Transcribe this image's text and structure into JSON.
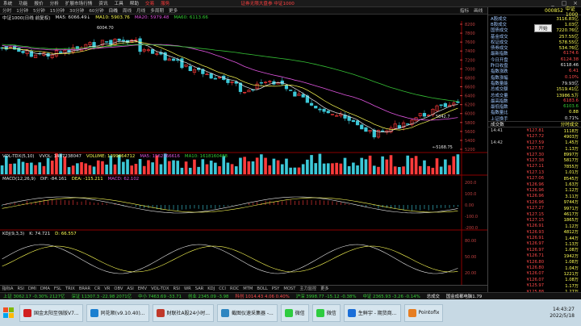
{
  "colors": {
    "up": "#ff3b3b",
    "down": "#3cc8d8",
    "ma5": "#e8e8e8",
    "ma10": "#ffff55",
    "ma20": "#e055e0",
    "ma60": "#35c035",
    "background": "#000000"
  },
  "menu": {
    "items": [
      "系统",
      "功能",
      "报价",
      "分析",
      "扩展市场行情",
      "资讯",
      "工具",
      "帮助"
    ],
    "badges": [
      "交易",
      "服务"
    ],
    "notice": "证券无限大盘参  中证1000",
    "window_buttons": [
      "_",
      "□",
      "×"
    ]
  },
  "toolbar": {
    "periods": [
      "分时",
      "1分钟",
      "5分钟",
      "15分钟",
      "30分钟",
      "60分钟",
      "日线",
      "周线",
      "月线",
      "多周期",
      "更多"
    ],
    "tools": [
      "指标",
      "画线",
      "复权",
      "叠加",
      "统计",
      "标记",
      "F10",
      "F11",
      "对比"
    ]
  },
  "chart_header": {
    "title": "中证1000(日线 前复权)",
    "ma5": "MA5: 6066.49↓",
    "ma10": "MA10: 5903.76",
    "ma20": "MA20: 5979.48",
    "ma60": "MA60: 6113.66"
  },
  "volume_header": {
    "label": "VOL-TDX(5,10)",
    "vvol": "VVOL: 1487238047",
    "volume": "VOLUME: 1399864712",
    "ma5": "MA5: 1562366616",
    "ma10": "MA10: 1618160488"
  },
  "macd_header": {
    "label": "MACD(12,26,9)",
    "dif": "DIF: -84.161",
    "dea": "DEA: -115.211",
    "macd": "MACD: 62.102"
  },
  "kdj_header": {
    "label": "KDJ(9,3,3)",
    "k": "K: 74.721",
    "d": "D: 66.557"
  },
  "annotations": {
    "high_marker": "6004.70",
    "low_marker": "5168.75",
    "recent_marker": "5842.7"
  },
  "price_axis": [
    "8200",
    "7800",
    "7600",
    "7400",
    "7200",
    "7000",
    "6800",
    "6600",
    "6400",
    "6200",
    "6000",
    "5800",
    "5600",
    "5400",
    "5200"
  ],
  "macd_axis": [
    "200.0",
    "100.0",
    "0.00",
    "-100.0",
    "-200.0"
  ],
  "kdj_axis": [
    "80.00",
    "50.00",
    "20.00"
  ],
  "indicator_tabs": [
    "指标A",
    "RSI",
    "DMI",
    "DMA",
    "FSL",
    "TRIX",
    "BRAR",
    "CR",
    "VR",
    "OBV",
    "ASI",
    "EMV",
    "VOL-TDX",
    "RSI",
    "WR",
    "SAR",
    "KDJ",
    "CCI",
    "ROC",
    "MTM",
    "BOLL",
    "PSY",
    "MOST",
    "主力监控",
    "更多"
  ],
  "index_bar": [
    {
      "name": "上证",
      "value": "3062.17",
      "change": "-0.30%",
      "amount": "2127亿",
      "dir": "down"
    },
    {
      "name": "深证",
      "value": "11307.3",
      "change": "-22.98",
      "amount": "2071亿",
      "dir": "down"
    },
    {
      "name": "中小",
      "value": "7463.69",
      "change": "-33.71",
      "amount": "",
      "dir": "down"
    },
    {
      "name": "创业",
      "value": "2345.09",
      "change": "-3.98",
      "amount": "",
      "dir": "down"
    },
    {
      "name": "科创",
      "value": "1014.43",
      "change": "4.06",
      "amount": "0.40%",
      "dir": "up"
    },
    {
      "name": "沪深",
      "value": "3998.77",
      "change": "-15.12",
      "amount": "-0.38%",
      "dir": "down"
    },
    {
      "name": "中证",
      "value": "2365.93",
      "change": "-3.26",
      "amount": "-0.14%",
      "dir": "down"
    },
    {
      "name": "",
      "value": "总成交",
      "change": "",
      "amount": "",
      "dir": "none"
    },
    {
      "name": "",
      "value": "国金成都电脑1.79",
      "change": "",
      "amount": "",
      "dir": "none"
    }
  ],
  "taskbar": {
    "items": [
      "国金太阳至强版V7...",
      "同花顺(v9.10.40)...",
      "财联社A股24小时...",
      "截图仪速采集器 -...",
      "微信",
      "微信",
      "生鲜宇 - 期货商...",
      "Pointofix"
    ],
    "time": "14:43:27",
    "date": "2022/5/18"
  },
  "right_panel": {
    "code": "000852",
    "name": "中证1000",
    "popup": "开始",
    "quotes": [
      {
        "k": "A股成交",
        "v": "3116.83亿",
        "c": "yel"
      },
      {
        "k": "B股成交",
        "v": "1.03亿",
        "c": "yel"
      },
      {
        "k": "国债成交",
        "v": "7220.76亿",
        "c": "yel"
      },
      {
        "k": "基金成交",
        "v": "257.55亿",
        "c": "yel"
      },
      {
        "k": "权证成交",
        "v": "578.55亿",
        "c": "yel"
      },
      {
        "k": "债券成交",
        "v": "534.76亿",
        "c": "yel"
      },
      {
        "k": "最新指数",
        "v": "6174.6",
        "c": "up"
      },
      {
        "k": "今日开盘",
        "v": "6124.38",
        "c": "up"
      },
      {
        "k": "昨日收盘",
        "v": "6118.46",
        "c": "wh"
      },
      {
        "k": "指数涨跌",
        "v": "6.41",
        "c": "up"
      },
      {
        "k": "指数涨幅",
        "v": "0.10%",
        "c": "up"
      },
      {
        "k": "指数量能",
        "v": "79.93亿",
        "c": "wh"
      },
      {
        "k": "总成交额",
        "v": "1519.41亿",
        "c": "yel"
      },
      {
        "k": "总成交量",
        "v": "13986.5万",
        "c": "yel"
      },
      {
        "k": "最高指数",
        "v": "6183.6",
        "c": "up"
      },
      {
        "k": "最低指数",
        "v": "6103.6",
        "c": "dn"
      },
      {
        "k": "指数量比",
        "v": "0.88",
        "c": "yel"
      },
      {
        "k": "上证换手",
        "v": "0.71%",
        "c": "wh"
      }
    ],
    "trade_header": {
      "left": "成交数",
      "right": "分时成交"
    },
    "trade_times": [
      "14:41",
      "14:42"
    ],
    "trades": [
      {
        "p": "¥127.81",
        "s": "1118万"
      },
      {
        "p": "¥127.72",
        "s": "4903万"
      },
      {
        "p": "¥127.59",
        "s": "1.45万"
      },
      {
        "p": "¥127.57",
        "s": "1.13万"
      },
      {
        "p": "¥127.30",
        "s": "8997万"
      },
      {
        "p": "¥127.38",
        "s": "5817万"
      },
      {
        "p": "¥127.11",
        "s": "7855万"
      },
      {
        "p": "¥127.13",
        "s": "1.01万"
      },
      {
        "p": "¥127.06",
        "s": "8545万"
      },
      {
        "p": "¥126.96",
        "s": "1.63万"
      },
      {
        "p": "¥126.96",
        "s": "1.12万"
      },
      {
        "p": "¥126.96",
        "s": "3.11万"
      },
      {
        "p": "¥126.96",
        "s": "9744万"
      },
      {
        "p": "¥127.27",
        "s": "9971万"
      },
      {
        "p": "¥127.15",
        "s": "4617万"
      },
      {
        "p": "¥127.15",
        "s": "1865万"
      },
      {
        "p": "¥126.91",
        "s": "1.12万"
      },
      {
        "p": "¥126.93",
        "s": "4812万"
      },
      {
        "p": "¥126.91",
        "s": "1.44万"
      },
      {
        "p": "¥126.97",
        "s": "1.13万"
      },
      {
        "p": "¥126.97",
        "s": "1.08万"
      },
      {
        "p": "¥126.71",
        "s": "1942万"
      },
      {
        "p": "¥126.80",
        "s": "1.08万"
      },
      {
        "p": "¥126.80",
        "s": "1.04万"
      },
      {
        "p": "¥126.07",
        "s": "1221万"
      },
      {
        "p": "¥126.07",
        "s": "1.08万"
      },
      {
        "p": "¥125.97",
        "s": "1.17万"
      },
      {
        "p": "¥125.88",
        "s": "1.27万"
      },
      {
        "p": "¥125.71",
        "s": "1.05万"
      },
      {
        "p": "¥125.71",
        "s": "1.15万"
      },
      {
        "p": "¥124.92",
        "s": "1.16万"
      },
      {
        "p": "¥124.96",
        "s": "1.09万"
      },
      {
        "p": "¥124.87",
        "s": "1.34万"
      }
    ]
  }
}
